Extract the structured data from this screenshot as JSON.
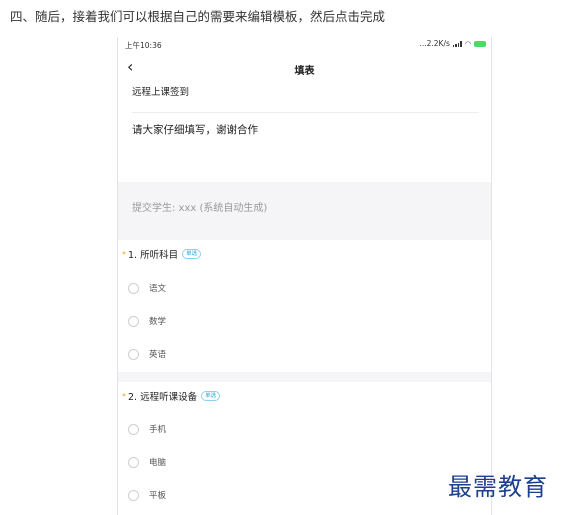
{
  "intro_text": "四、随后，接着我们可以根据自己的需要来编辑模板，然后点击完成",
  "status_bar": {
    "time": "上午10:36",
    "network": "...2.2K/s",
    "battery_level": "96"
  },
  "nav": {
    "title": "填表"
  },
  "form": {
    "title": "远程上课签到",
    "description": "请大家仔细填写，谢谢合作",
    "submitter": "提交学生: xxx (系统自动生成)"
  },
  "questions": [
    {
      "number_label": "1. 所听科目",
      "badge": "单选",
      "options": [
        "语文",
        "数学",
        "英语"
      ]
    },
    {
      "number_label": "2. 远程听课设备",
      "badge": "单选",
      "options": [
        "手机",
        "电脑",
        "平板"
      ]
    }
  ],
  "watermark": "最需教育",
  "colors": {
    "required_mark": "#f5a623",
    "badge": "#2fa6d8",
    "section_bg": "#f5f5f7",
    "watermark": "#1d3f8f"
  }
}
